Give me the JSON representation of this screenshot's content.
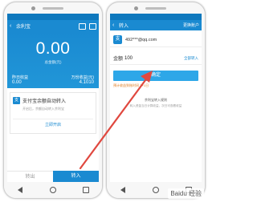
{
  "colors": {
    "brand": "#1a8ad1",
    "button": "#2ea7e8",
    "arrow": "#e0483f",
    "note": "#e07b1e"
  },
  "left_screen": {
    "app_title": "余利宝",
    "back_glyph": "‹",
    "balance": "0.00",
    "balance_label": "总金额(元)",
    "yesterday_label": "昨日收益",
    "yesterday_value": "0.00",
    "yield_label": "万份收益(元)",
    "yield_value": "4.1010",
    "card_logo": "支",
    "card_title": "支付宝余额自动转入",
    "card_desc": "开启后，余额自动转入余利宝",
    "card_button": "立即开启",
    "transfer_out": "转出",
    "transfer_in": "转入"
  },
  "right_screen": {
    "page_title": "转入",
    "header_action": "更换账户",
    "account_logo": "支",
    "account_email": "492***@qq.com",
    "amount_label": "金额",
    "amount_value": "100",
    "all_label": "全部转入",
    "confirm_label": "确定",
    "note": "预计收益到账时间 T+1日",
    "rule_title": "余利宝转入规则",
    "rule_detail": "转入资金当日计算收益，次日可查看收益"
  },
  "watermark": "Baidu 经验"
}
